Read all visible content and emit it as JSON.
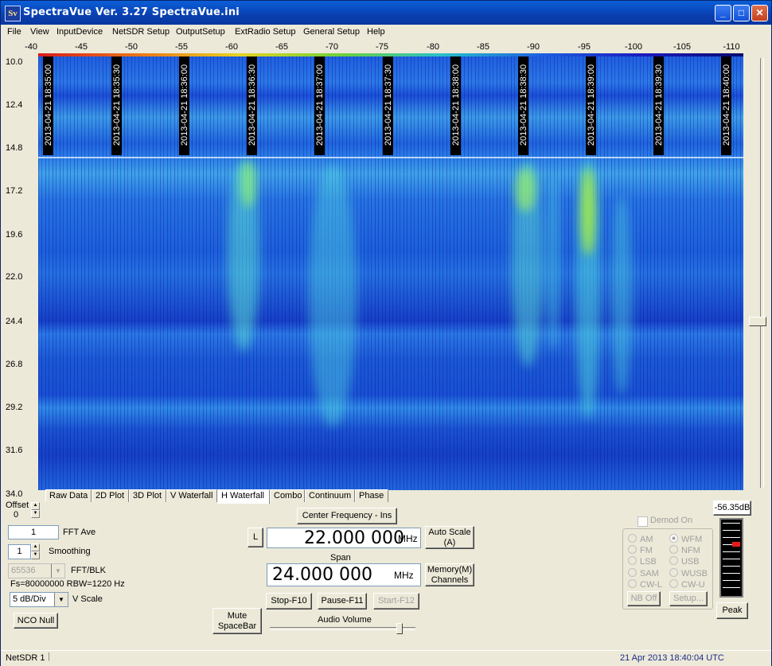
{
  "window": {
    "title": "SpectraVue Ver. 3.27  SpectraVue.ini",
    "icon_text": "Sv"
  },
  "menu": [
    "File",
    "View",
    "InputDevice",
    "NetSDR Setup",
    "OutputSetup",
    "ExtRadio Setup",
    "General Setup",
    "Help"
  ],
  "db_scale": [
    "-40",
    "-45",
    "-50",
    "-55",
    "-60",
    "-65",
    "-70",
    "-75",
    "-80",
    "-85",
    "-90",
    "-95",
    "-100",
    "-105",
    "-110"
  ],
  "freq_axis": [
    "10.0",
    "12.4",
    "14.8",
    "17.2",
    "19.6",
    "22.0",
    "24.4",
    "26.8",
    "29.2",
    "31.6",
    "34.0"
  ],
  "timestamps": [
    "2013-04-21 18:35:00",
    "2013-04-21 18:35:30",
    "2013-04-21 18:36:00",
    "2013-04-21 18:36:30",
    "2013-04-21 18:37:00",
    "2013-04-21 18:37:30",
    "2013-04-21 18:38:00",
    "2013-04-21 18:38:30",
    "2013-04-21 18:39:00",
    "2013-04-21 18:39:30",
    "2013-04-21 18:40:00"
  ],
  "tabs": [
    "Raw Data",
    "2D Plot",
    "3D Plot",
    "V Waterfall",
    "H Waterfall",
    "Combo",
    "Continuum",
    "Phase"
  ],
  "active_tab": "H Waterfall",
  "controls": {
    "offset_label": "Offset",
    "offset_value": "0",
    "fft_ave_value": "1",
    "fft_ave_label": "FFT Ave",
    "smoothing_value": "1",
    "smoothing_label": "Smoothing",
    "fft_blk_value": "65536",
    "fft_blk_label": "FFT/BLK",
    "fs_info": "Fs=80000000 RBW=1220 Hz",
    "vscale_value": "5 dB/Div",
    "vscale_label": "V Scale",
    "nco_null": "NCO Null",
    "mute": "Mute\nSpaceBar",
    "center_freq_button": "Center Frequency - Ins",
    "l_button": "L",
    "center_freq": "22.000 000",
    "center_unit": "MHz",
    "auto_scale": "Auto Scale\n(A)",
    "span_label": "Span",
    "span_value": "24.000 000",
    "span_unit": "MHz",
    "memory": "Memory(M)\nChannels",
    "stop": "Stop-F10",
    "pause": "Pause-F11",
    "start": "Start-F12",
    "audio_volume": "Audio Volume",
    "audio_level": 0.9
  },
  "demod": {
    "checkbox": "Demod On",
    "modes_left": [
      "AM",
      "FM",
      "LSB",
      "SAM",
      "CW-L"
    ],
    "modes_right": [
      "WFM",
      "NFM",
      "USB",
      "WUSB",
      "CW-U"
    ],
    "selected": "WFM",
    "nb_off": "NB Off",
    "setup": "Setup..."
  },
  "meter": {
    "readout": "-56.35dB",
    "peak_button": "Peak"
  },
  "status": {
    "device": "NetSDR 1",
    "datetime": "21 Apr 2013  18:40:04 UTC"
  },
  "colors": {
    "title_bar": "#0a3fb0",
    "waterfall_base": "#1f5fe0",
    "signal_green": "#9be84a"
  }
}
